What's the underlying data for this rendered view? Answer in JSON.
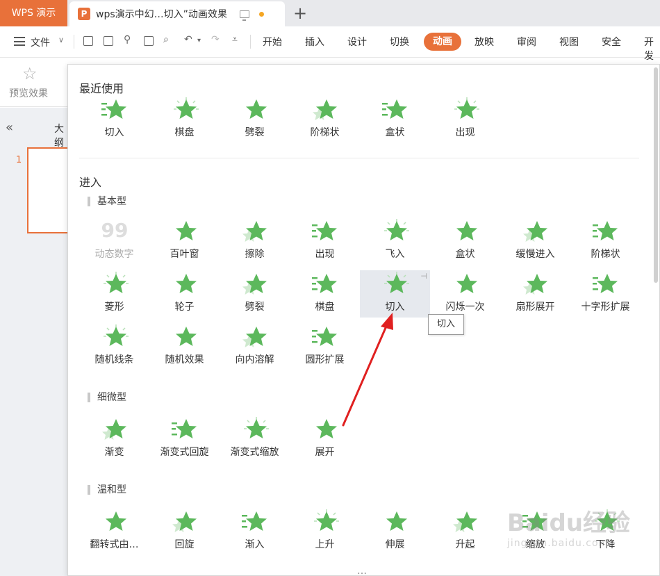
{
  "titlebar": {
    "app_name": "WPS 演示",
    "doc_icon": "P",
    "doc_title": "wps演示中幻…切入”动画效果",
    "new_tab": "+"
  },
  "menubar": {
    "file_label": "文件",
    "tabs": [
      "开始",
      "插入",
      "设计",
      "切换",
      "动画",
      "放映",
      "审阅",
      "视图",
      "安全",
      "开发"
    ],
    "active_tab": "动画"
  },
  "ribbon": {
    "preview_label": "预览效果"
  },
  "leftpane": {
    "outline_label": "大纲",
    "slide_number": "1"
  },
  "panel": {
    "recent_title": "最近使用",
    "recent_items": [
      "切入",
      "棋盘",
      "劈裂",
      "阶梯状",
      "盒状",
      "出现"
    ],
    "enter_title": "进入",
    "basic_title": "基本型",
    "basic_items": [
      "动态数字",
      "百叶窗",
      "擦除",
      "出现",
      "飞入",
      "盒状",
      "缓慢进入",
      "阶梯状",
      "菱形",
      "轮子",
      "劈裂",
      "棋盘",
      "切入",
      "闪烁一次",
      "扇形展开",
      "十字形扩展",
      "随机线条",
      "随机效果",
      "向内溶解",
      "圆形扩展"
    ],
    "subtle_title": "细微型",
    "subtle_items": [
      "渐变",
      "渐变式回旋",
      "渐变式缩放",
      "展开"
    ],
    "moderate_title": "温和型",
    "moderate_items": [
      "翻转式由…",
      "回旋",
      "渐入",
      "上升",
      "伸展",
      "升起",
      "缩放",
      "下降"
    ],
    "more_indicator": "…"
  },
  "tooltip": {
    "text": "切入"
  },
  "watermark": {
    "main": "Baidu经验",
    "sub": "jingyan.baidu.com"
  },
  "colors": {
    "accent": "#e8713a",
    "star": "#5cb85c",
    "arrow": "#e02020"
  }
}
